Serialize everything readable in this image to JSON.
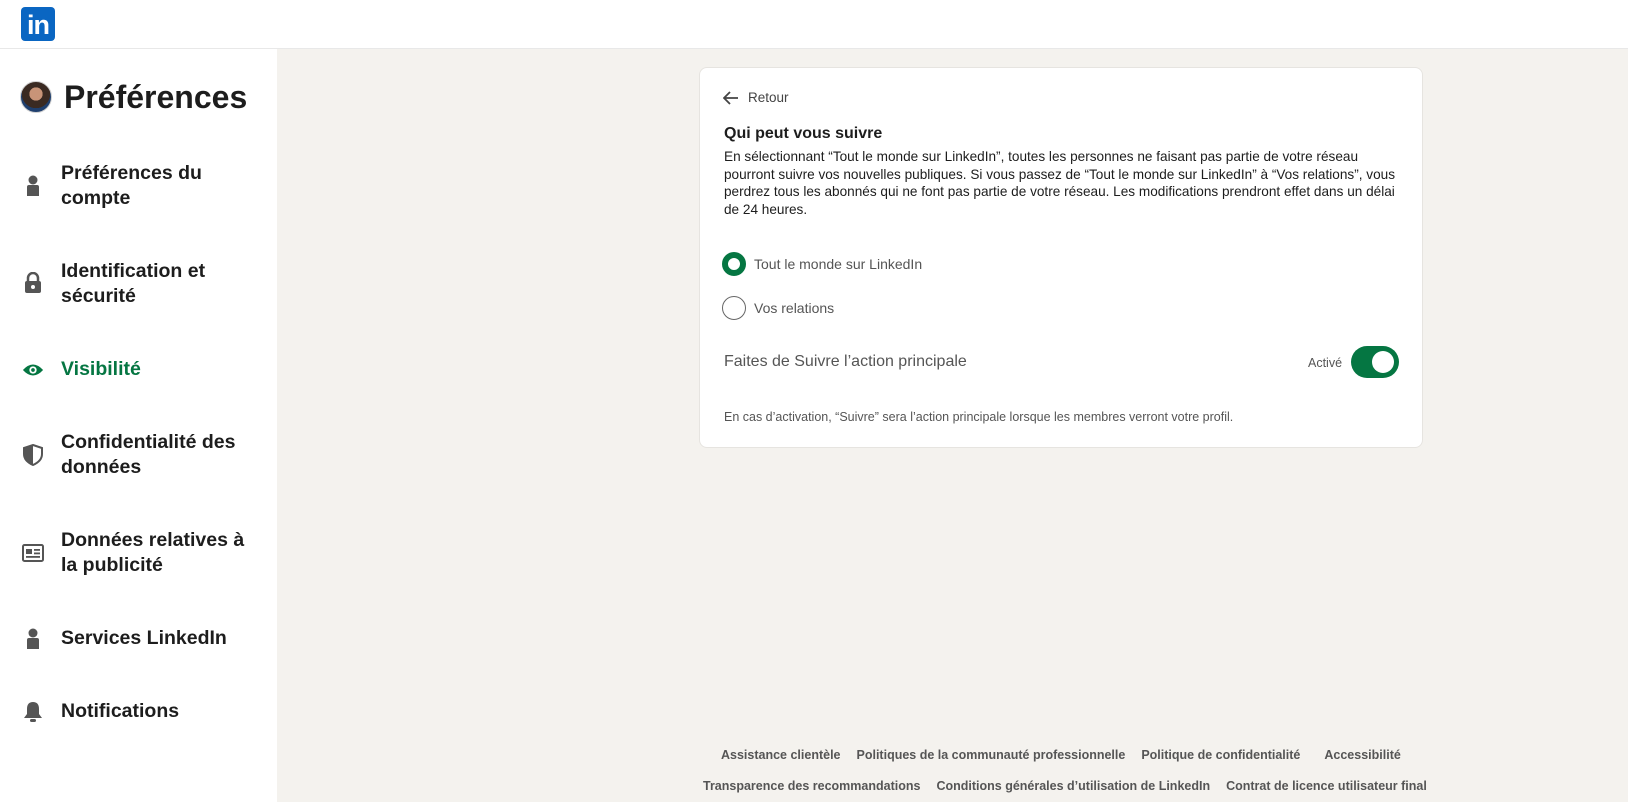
{
  "header": {
    "logo_text": "in"
  },
  "sidebar": {
    "title": "Préférences",
    "items": [
      {
        "label": "Préférences du compte",
        "icon": "person-icon",
        "active": false
      },
      {
        "label": "Identification et sécurité",
        "icon": "lock-icon",
        "active": false
      },
      {
        "label": "Visibilité",
        "icon": "eye-icon",
        "active": true
      },
      {
        "label": "Confidentialité des données",
        "icon": "shield-icon",
        "active": false
      },
      {
        "label": "Données relatives à la publicité",
        "icon": "newspaper-icon",
        "active": false
      },
      {
        "label": "Services LinkedIn",
        "icon": "person-icon",
        "active": false
      },
      {
        "label": "Notifications",
        "icon": "bell-icon",
        "active": false
      }
    ]
  },
  "main": {
    "back_label": "Retour",
    "section_title": "Qui peut vous suivre",
    "section_description": "En sélectionnant “Tout le monde sur LinkedIn”, toutes les personnes ne faisant pas partie de votre réseau pourront suivre vos nouvelles publiques. Si vous passez de “Tout le monde sur LinkedIn” à “Vos relations”, vous perdrez tous les abonnés qui ne font pas partie de votre réseau. Les modifications prendront effet dans un délai de 24 heures.",
    "options": [
      {
        "label": "Tout le monde sur LinkedIn",
        "checked": true
      },
      {
        "label": "Vos relations",
        "checked": false
      }
    ],
    "toggle": {
      "label": "Faites de Suivre l’action principale",
      "status": "Activé",
      "on": true,
      "note": "En cas d’activation, “Suivre” sera l’action principale lorsque les membres verront votre profil."
    }
  },
  "footer": {
    "row1": [
      "Assistance clientèle",
      "Politiques de la communauté professionnelle",
      "Politique de confidentialité",
      "Accessibilité"
    ],
    "row2": [
      "Transparence des recommandations",
      "Conditions générales d’utilisation de LinkedIn",
      "Contrat de licence utilisateur final"
    ]
  },
  "colors": {
    "accent": "#057642",
    "brand": "#0a66c2",
    "background": "#f4f2ee"
  }
}
